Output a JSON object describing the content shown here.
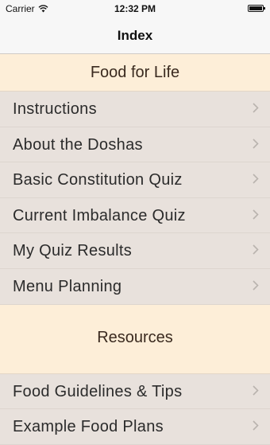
{
  "status": {
    "carrier": "Carrier",
    "time": "12:32 PM",
    "battery_level": 1.0
  },
  "navbar": {
    "title": "Index"
  },
  "sections": [
    {
      "title": "Food for Life",
      "items": [
        "Instructions",
        "About the Doshas",
        "Basic Constitution Quiz",
        "Current Imbalance Quiz",
        "My Quiz Results",
        "Menu Planning"
      ]
    },
    {
      "title": "Resources",
      "items": [
        "Food Guidelines & Tips",
        "Example Food Plans"
      ]
    }
  ],
  "icons": {
    "wifi": "wifi-icon",
    "chevron": "chevron-right-icon",
    "battery": "battery-icon"
  }
}
